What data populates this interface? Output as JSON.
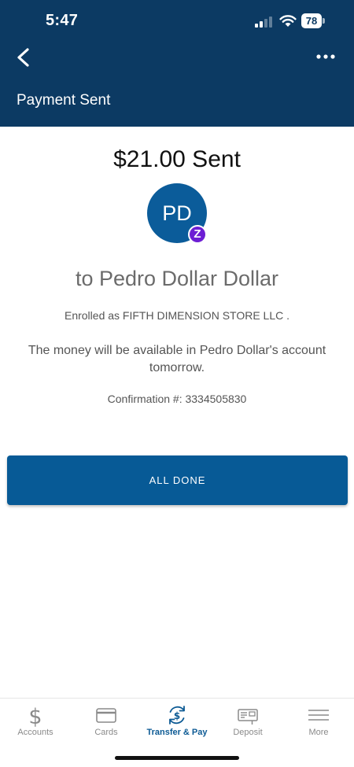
{
  "status_bar": {
    "time": "5:47",
    "battery": "78"
  },
  "header": {
    "title": "Payment Sent",
    "back_icon": "chevron-left-icon",
    "more_icon": "ellipsis-icon"
  },
  "payment": {
    "amount_text": "$21.00 Sent",
    "avatar_initials": "PD",
    "badge_icon": "zelle-icon",
    "badge_glyph": "Z",
    "recipient_text": "to Pedro Dollar Dollar",
    "enrolled_text": "Enrolled as FIFTH DIMENSION STORE LLC .",
    "availability_text": "The money will be available in Pedro Dollar's account tomorrow.",
    "confirmation_text": "Confirmation #: 3334505830"
  },
  "actions": {
    "all_done_label": "ALL DONE"
  },
  "tabbar": {
    "tabs": [
      {
        "label": "Accounts",
        "icon": "dollar-icon",
        "active": false
      },
      {
        "label": "Cards",
        "icon": "card-icon",
        "active": false
      },
      {
        "label": "Transfer & Pay",
        "icon": "transfer-icon",
        "active": true
      },
      {
        "label": "Deposit",
        "icon": "check-deposit-icon",
        "active": false
      },
      {
        "label": "More",
        "icon": "menu-icon",
        "active": false
      }
    ]
  },
  "colors": {
    "header_bg": "#0c3a63",
    "primary_button": "#075a96",
    "avatar_bg": "#0b5c9a",
    "zelle_purple": "#6d1ed4",
    "active_tab": "#0c5a94"
  }
}
